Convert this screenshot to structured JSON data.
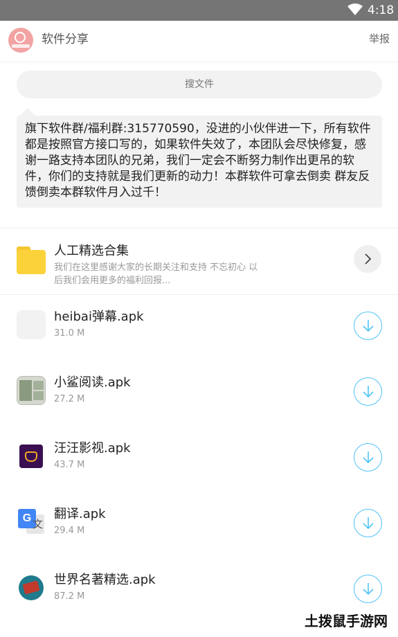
{
  "status_bar": {
    "time": "4:18"
  },
  "header": {
    "title": "软件分享",
    "report_label": "举报"
  },
  "search": {
    "placeholder": "搜文件"
  },
  "notice": {
    "text": "旗下软件群/福利群:315770590，没进的小伙伴进一下，所有软件都是按照官方接口写的，如果软件失效了，本团队会尽快修复，感谢一路支持本团队的兄弟，我们一定会不断努力制作出更吊的软件，你们的支持就是我们更新的动力！本群软件可拿去倒卖 群友反馈倒卖本群软件月入过千！"
  },
  "folder": {
    "title": "人工精选合集",
    "description": "我们在这里感谢大家的长期关注和支持 不忘初心 以后我们会用更多的福利回报..."
  },
  "files": [
    {
      "name": "heibai弹幕.apk",
      "size": "31.0 M",
      "icon": "blank-app-icon"
    },
    {
      "name": "小鲨阅读.apk",
      "size": "27.2 M",
      "icon": "xiaosha-reading-icon"
    },
    {
      "name": "汪汪影视.apk",
      "size": "43.7 M",
      "icon": "wangwang-video-icon"
    },
    {
      "name": "翻译.apk",
      "size": "29.4 M",
      "icon": "translate-icon"
    },
    {
      "name": "世界名著精选.apk",
      "size": "87.2 M",
      "icon": "book-icon"
    }
  ],
  "watermark": {
    "text": "土拨鼠手游网"
  },
  "colors": {
    "accent": "#4fc3f7",
    "status_bar": "#757575",
    "folder": "#fcd23a"
  }
}
